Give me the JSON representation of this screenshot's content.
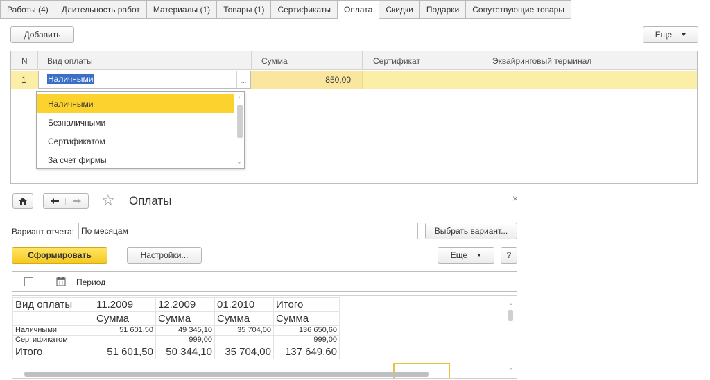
{
  "tabs": [
    "Работы (4)",
    "Длительность работ",
    "Материалы (1)",
    "Товары (1)",
    "Сертификаты",
    "Оплата",
    "Скидки",
    "Подарки",
    "Сопутствующие товары"
  ],
  "active_tab": "Оплата",
  "toolbar": {
    "add_label": "Добавить",
    "more_label": "Еще"
  },
  "payments_table": {
    "headers": {
      "n": "N",
      "type": "Вид оплаты",
      "sum": "Сумма",
      "certificate": "Сертификат",
      "terminal": "Эквайринговый терминал"
    },
    "rows": [
      {
        "n": "1",
        "type": "Наличными",
        "sum": "850,00",
        "certificate": "",
        "terminal": ""
      }
    ],
    "ellipsis": "..."
  },
  "dropdown": {
    "options": [
      "Наличными",
      "Безналичными",
      "Сертификатом",
      "За счет фирмы"
    ],
    "selected": "Наличными"
  },
  "report": {
    "title": "Оплаты",
    "variant_label": "Вариант отчета:",
    "variant_value": "По месяцам",
    "choose_variant_label": "Выбрать вариант...",
    "generate_label": "Сформировать",
    "settings_label": "Настройки...",
    "more_label": "Еще",
    "help_label": "?",
    "period_label": "Период",
    "close_label": "×",
    "table": {
      "header_type": "Вид оплаты",
      "periods": [
        "11.2009",
        "12.2009",
        "01.2010",
        "Итого"
      ],
      "sum_label": "Сумма",
      "rows": [
        {
          "name": "Наличными",
          "values": [
            "51 601,50",
            "49 345,10",
            "35 704,00",
            "136 650,60"
          ]
        },
        {
          "name": "Сертификатом",
          "values": [
            "",
            "999,00",
            "",
            "999,00"
          ]
        }
      ],
      "total": {
        "name": "Итого",
        "values": [
          "51 601,50",
          "50 344,10",
          "35 704,00",
          "137 649,60"
        ]
      }
    }
  },
  "colors": {
    "accent_yellow": "#fcd22f",
    "row_highlight": "#fbefa8",
    "selection_blue": "#3a6fc8"
  },
  "icons": {
    "home": "home-icon",
    "back": "arrow-left-icon",
    "forward": "arrow-right-icon",
    "favorite": "star-icon",
    "calendar": "calendar-icon",
    "dropdown": "chevron-down-icon"
  }
}
